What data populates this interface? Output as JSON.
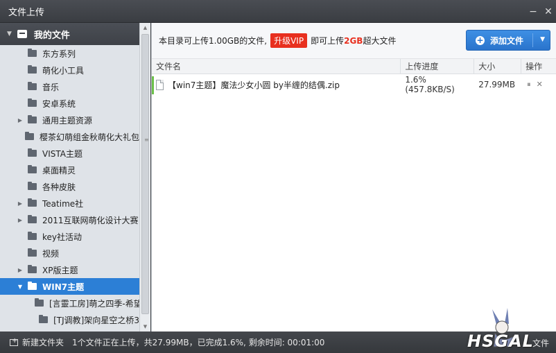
{
  "window": {
    "title": "文件上传",
    "minimize": "−",
    "close": "✕"
  },
  "sidebar": {
    "root_label": "我的文件",
    "items": [
      {
        "label": "东方系列",
        "expandable": false,
        "level": 1
      },
      {
        "label": "萌化小工具",
        "expandable": false,
        "level": 1
      },
      {
        "label": "音乐",
        "expandable": false,
        "level": 1
      },
      {
        "label": "安卓系统",
        "expandable": false,
        "level": 1
      },
      {
        "label": "通用主题资源",
        "expandable": true,
        "level": 1
      },
      {
        "label": "樱茶幻萌组金秋萌化大礼包",
        "expandable": false,
        "level": 1
      },
      {
        "label": "VISTA主题",
        "expandable": false,
        "level": 1
      },
      {
        "label": "桌面精灵",
        "expandable": false,
        "level": 1
      },
      {
        "label": "各种皮肤",
        "expandable": false,
        "level": 1
      },
      {
        "label": "Teatime社",
        "expandable": true,
        "level": 1
      },
      {
        "label": "2011互联网萌化设计大赛",
        "expandable": true,
        "level": 1
      },
      {
        "label": "key社活动",
        "expandable": false,
        "level": 1
      },
      {
        "label": "视频",
        "expandable": false,
        "level": 1
      },
      {
        "label": "XP版主题",
        "expandable": true,
        "level": 1
      },
      {
        "label": "WIN7主题",
        "expandable": true,
        "expanded": true,
        "selected": true,
        "level": 1
      },
      {
        "label": "[言靈工房]萌之四季-希望",
        "expandable": false,
        "level": 2
      },
      {
        "label": "[TJ调教]架向星空之桥3",
        "expandable": false,
        "level": 2
      }
    ]
  },
  "infobar": {
    "text_before": "本目录可上传1.00GB的文件,",
    "vip_badge": "升级VIP",
    "text_middle": "即可上传",
    "highlight": "2GB",
    "text_after": "超大文件",
    "add_button": "添加文件"
  },
  "table": {
    "headers": {
      "name": "文件名",
      "progress": "上传进度",
      "size": "大小",
      "op": "操作"
    },
    "rows": [
      {
        "name": "【win7主题】魔法少女小圆 by半缠的结偶.zip",
        "progress": "1.6%(457.8KB/S)",
        "size": "27.99MB",
        "pause": "⏸",
        "remove": "✕"
      }
    ]
  },
  "statusbar": {
    "new_folder": "新建文件夹",
    "status": "1个文件正在上传，共27.99MB，已完成1.6%, 剩余时间: 00:01:00",
    "right": "文件"
  },
  "watermark": {
    "text": "HSGAL"
  },
  "colors": {
    "accent": "#2c7fd6",
    "vip": "#e8301f",
    "progress": "#6cc04a"
  }
}
